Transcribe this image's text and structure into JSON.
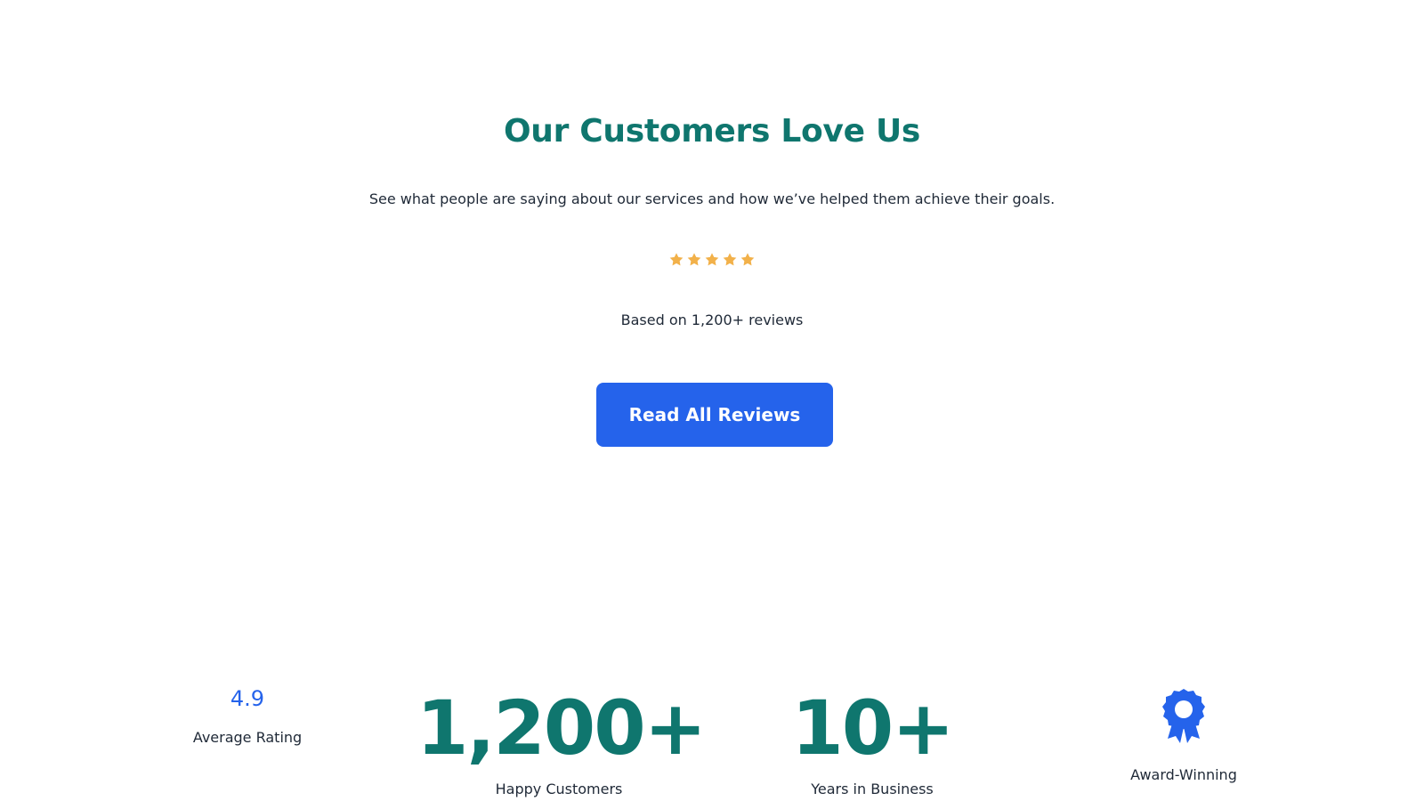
{
  "hero": {
    "title": "Our Customers Love Us",
    "subtitle": "See what people are saying about our services and how we’ve helped them achieve their goals.",
    "rating_stars": 5,
    "reviews_text": "Based on 1,200+ reviews",
    "cta_label": "Read All Reviews"
  },
  "stats": {
    "rating": {
      "value": "4.9",
      "label": "Average Rating"
    },
    "customers": {
      "value": "1,200+",
      "label": "Happy Customers"
    },
    "years": {
      "value": "10+",
      "label": "Years in Business"
    },
    "award": {
      "icon": "award-ribbon-icon",
      "label": "Award-Winning"
    }
  },
  "colors": {
    "accent": "#2563eb",
    "title": "#0f766e",
    "star": "#f59e0b"
  }
}
